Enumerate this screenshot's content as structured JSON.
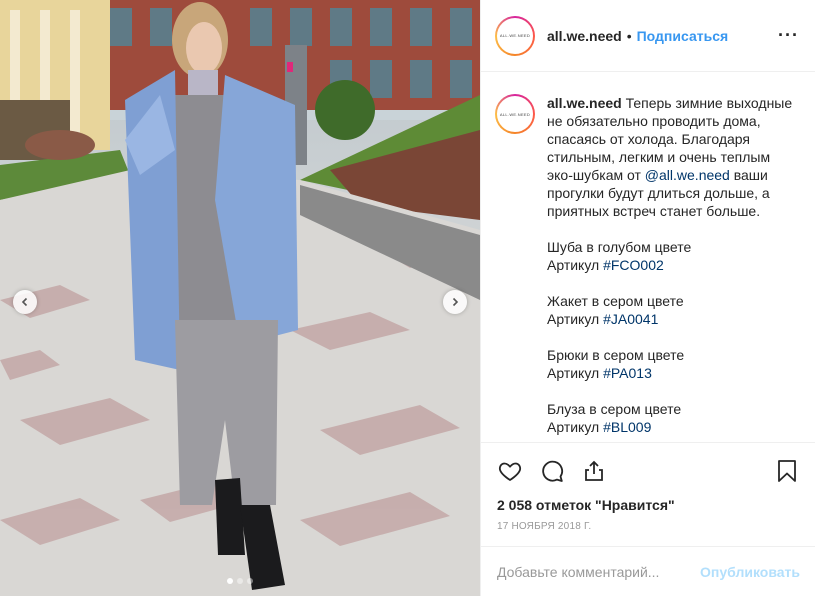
{
  "post": {
    "username": "all.we.need",
    "separator": "•",
    "follow_label": "Подписаться",
    "more_icon": "more-icon",
    "avatar_text": "ALL.WE.NEED",
    "accent": "#3897f0"
  },
  "caption": {
    "username": "all.we.need",
    "intro_before": " Теперь зимние выходные не обязательно проводить дома, спасаясь от холода. Благодаря стильным, легким и очень теплым эко-шубкам от ",
    "mention": "@all.we.need",
    "intro_after": " ваши прогулки будут длиться дольше, а приятных встреч станет больше.",
    "items": [
      {
        "name": "Шуба в голубом цвете",
        "sku_label": "Артикул ",
        "sku_tag": "#FCO002"
      },
      {
        "name": "Жакет в сером цвете",
        "sku_label": "Артикул ",
        "sku_tag": "#JA0041"
      },
      {
        "name": "Брюки в сером цвете",
        "sku_label": "Артикул ",
        "sku_tag": "#PA013"
      },
      {
        "name": "Блуза в сером цвете",
        "sku_label": "Артикул ",
        "sku_tag": "#BL009"
      }
    ]
  },
  "actions": {
    "icons": [
      "heart-icon",
      "comment-icon",
      "share-icon",
      "bookmark-icon"
    ],
    "likes": "2 058 отметок \"Нравится\"",
    "date": "17 ноября 2018 г."
  },
  "comment": {
    "placeholder": "Добавьте комментарий...",
    "publish_label": "Опубликовать"
  },
  "carousel": {
    "total_slides": 3,
    "active_slide": 1
  }
}
